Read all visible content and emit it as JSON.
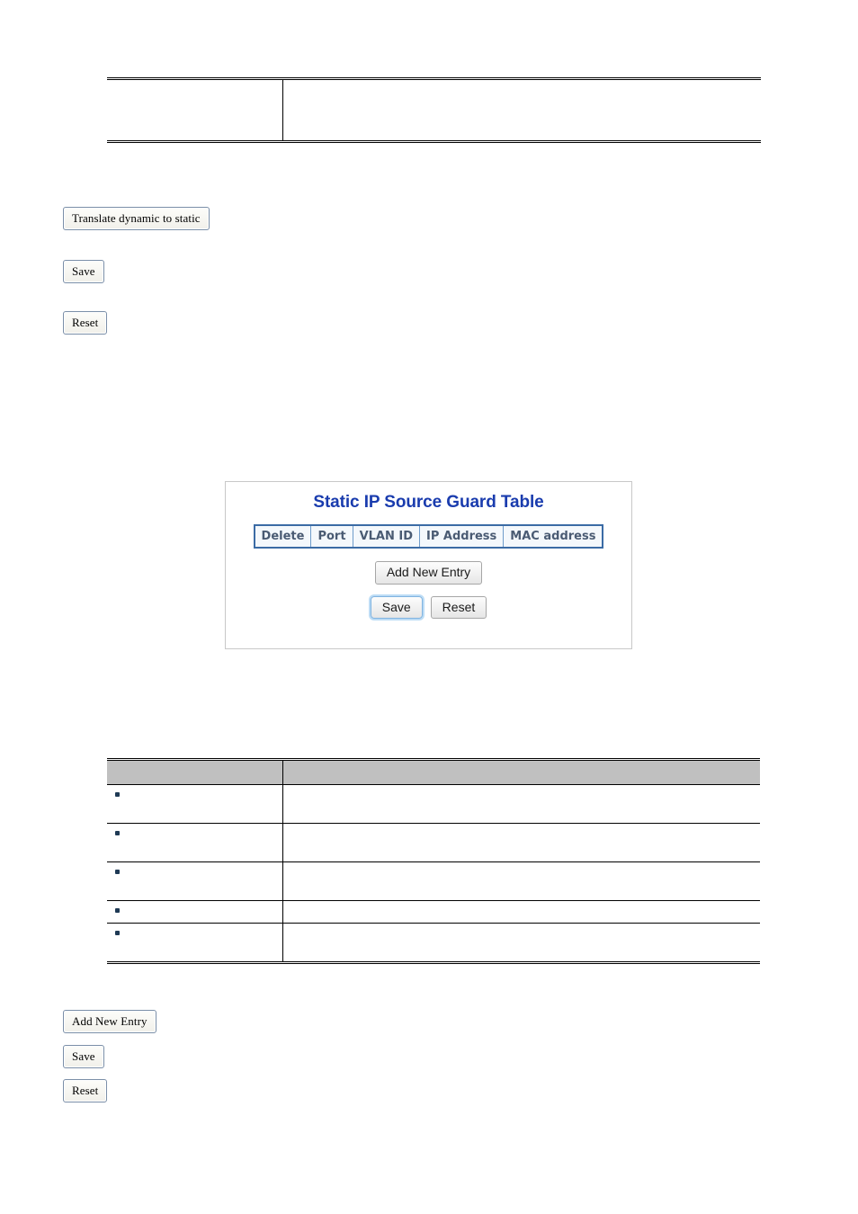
{
  "top_table": {
    "header_cells": [
      "",
      ""
    ],
    "rows": [
      {
        "left": "",
        "right": ""
      }
    ]
  },
  "top_buttons": {
    "translate_label": "Translate dynamic to static",
    "save_label": "Save",
    "reset_label": "Reset"
  },
  "static_ip_source_guard_panel": {
    "title": "Static IP Source Guard Table",
    "title_color": "#1a3cae",
    "columns": [
      "Delete",
      "Port",
      "VLAN ID",
      "IP Address",
      "MAC address"
    ],
    "rows": [],
    "add_new_entry_label": "Add New Entry",
    "save_label": "Save",
    "reset_label": "Reset",
    "focused_button": "Save"
  },
  "description_table": {
    "header": {
      "object": "",
      "description": ""
    },
    "header_bg": "#c0c0c0",
    "bullet_color": "#1f3a55",
    "rows": [
      {
        "object": "",
        "description": ""
      },
      {
        "object": "",
        "description": ""
      },
      {
        "object": "",
        "description": ""
      },
      {
        "object": "",
        "description": ""
      },
      {
        "object": "",
        "description": ""
      }
    ]
  },
  "bottom_buttons": {
    "add_new_entry_label": "Add New Entry",
    "save_label": "Save",
    "reset_label": "Reset"
  }
}
